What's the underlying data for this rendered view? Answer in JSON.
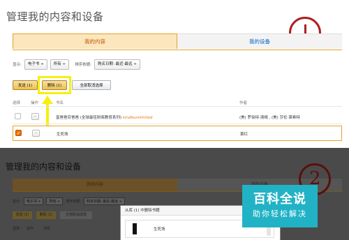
{
  "top_panel": {
    "page_title": "管理我的内容和设备",
    "tabs": [
      {
        "label": "我的内容",
        "active": true
      },
      {
        "label": "我的设备",
        "active": false
      }
    ],
    "filters": {
      "show_label": "显示:",
      "type_select": "电子书 ÷",
      "scope_select": "所有 ÷",
      "sort_label": "排序依据:",
      "sort_select": "购买日期: 最近-最远 ÷"
    },
    "buttons": {
      "send": "发送 (1)",
      "delete": "删除 (1)",
      "select_all": "全部取消选择"
    },
    "columns": {
      "select": "选择",
      "action": "操作",
      "title": "书名",
      "author": "作者"
    },
    "rows": [
      {
        "checked": false,
        "action": "...",
        "title": "富爸爸穷爸爸 (全球最佳财商教育系列)",
        "tag": "kindleunlimited",
        "author": "(美) 罗伯特·清崎 , (美) 莎伦·莱希特"
      },
      {
        "checked": true,
        "action": "...",
        "title": "生死场",
        "tag": "",
        "author": "萧红"
      }
    ],
    "step_marker": "1"
  },
  "bottom_panel": {
    "page_title": "管理我的内容和设备",
    "tabs": [
      {
        "label": "我的内容"
      },
      {
        "label": "我的设备"
      }
    ],
    "filters": {
      "show_label": "显示:",
      "type_select": "电子书 ÷",
      "scope_select": "所有 ÷",
      "sort_label": "排序依据:",
      "sort_select": "购买日期: 最近-最远 ÷"
    },
    "buttons": {
      "send": "发送 (1)",
      "delete": "删除 (1)",
      "select_all": "全部取消选择"
    },
    "columns": {
      "select": "选择",
      "action": "操作",
      "title": "书名"
    },
    "dialog": {
      "header": "从库 (1) 中删除书籍",
      "item_title": "生死场"
    },
    "step_marker": "2"
  },
  "watermark": {
    "main": "百科全说",
    "sub": "助你轻松解决"
  },
  "colors": {
    "accent_orange": "#e4a22a",
    "highlight_yellow": "#f7ef10",
    "marker_red": "#b01c1c",
    "watermark_teal": "#22b2c6",
    "link_blue": "#0066c0"
  }
}
